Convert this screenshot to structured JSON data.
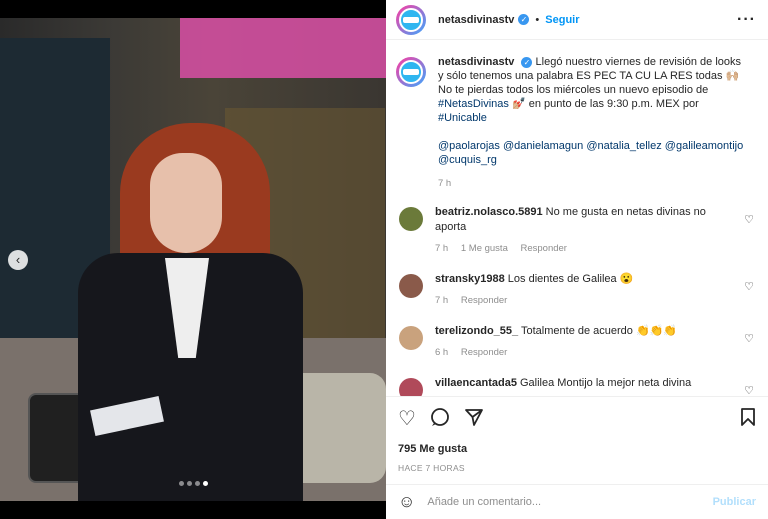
{
  "post": {
    "username": "netasdivinastv",
    "separator": "•",
    "follow_label": "Seguir",
    "more_label": "···",
    "caption": {
      "username": "netasdivinastv",
      "line1": "Llegó nuestro viernes de revisión de looks y sólo tenemos una palabra ES PEC TA CU LA RES todas 🙌🏼",
      "line2": "No te pierdas todos los miércoles un nuevo episodio de",
      "hashtag1": "#NetasDivinas",
      "line3": "💅🏼 en punto de las 9:30 p.m. MEX por",
      "hashtag2": "#Unicable",
      "mentions": [
        "@paolarojas",
        "@danielamagun",
        "@natalia_tellez",
        "@galileamontijo",
        "@cuquis_rg"
      ],
      "time": "7 h"
    }
  },
  "comments": [
    {
      "username": "beatriz.nolasco.5891",
      "text": "No me gusta en netas divinas no aporta",
      "time": "7 h",
      "likes": "1 Me gusta",
      "reply": "Responder",
      "avatar_color": "#6b7a3a"
    },
    {
      "username": "stransky1988",
      "text": "Los dientes de Galilea 😮",
      "time": "7 h",
      "reply": "Responder",
      "avatar_color": "#8a5a4a"
    },
    {
      "username": "terelizondo_55_",
      "text": "Totalmente de acuerdo 👏👏👏",
      "time": "6 h",
      "reply": "Responder",
      "avatar_color": "#c9a27d"
    },
    {
      "username": "villaencantada5",
      "text": "Galilea Montijo la mejor neta divina",
      "time": "",
      "reply": "",
      "avatar_color": "#b04a5a"
    }
  ],
  "actions": {
    "likes": "795 Me gusta",
    "date": "HACE 7 HORAS"
  },
  "composer": {
    "placeholder": "Añade un comentario...",
    "publish_label": "Publicar"
  },
  "carousel": {
    "prev_icon": "‹",
    "slides": 4,
    "active_slide": 4
  },
  "colors": {
    "link": "#0095f6",
    "hashtag": "#00376b",
    "muted": "#8e8e8e"
  }
}
